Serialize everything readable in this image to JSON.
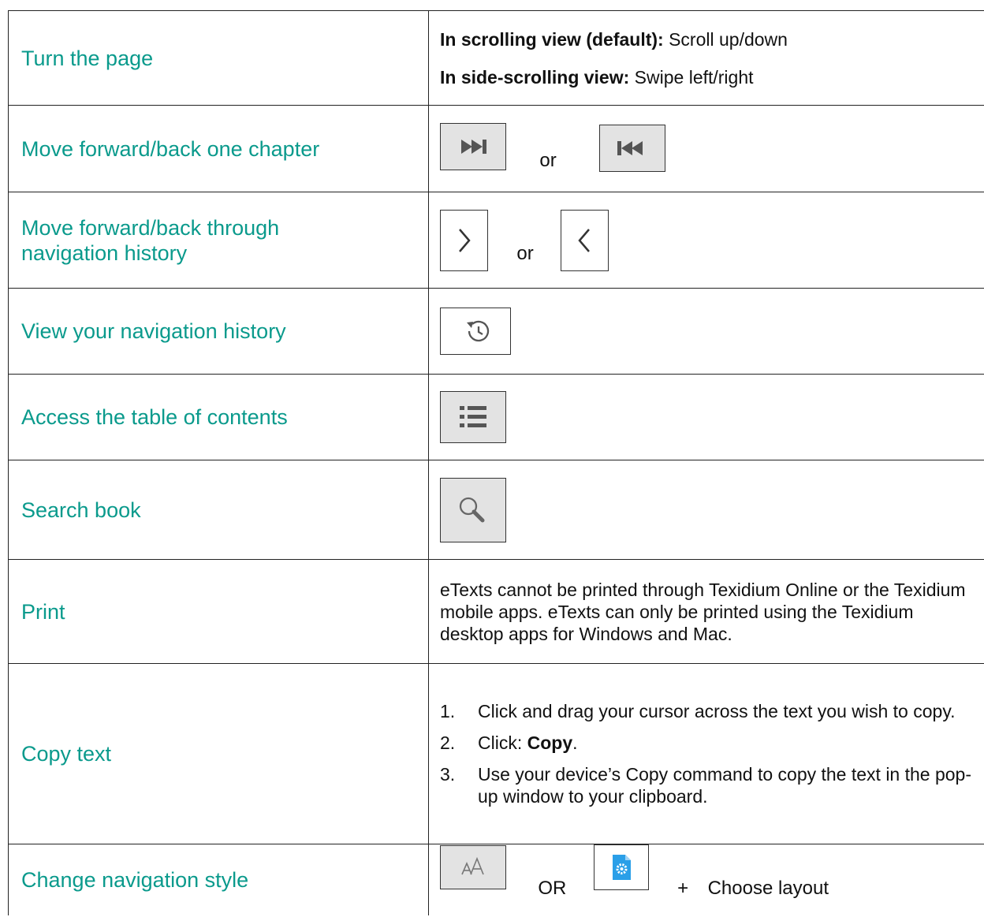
{
  "rows": [
    {
      "label": "Turn the page",
      "lines": [
        {
          "bold": "In scrolling view (default):",
          "text": " Scroll up/down"
        },
        {
          "bold": "In side-scrolling view:",
          "text": " Swipe left/right"
        }
      ]
    },
    {
      "label": "Move forward/back one chapter",
      "icons": [
        "skip-forward-icon",
        "skip-back-icon"
      ],
      "joiner": "or"
    },
    {
      "label": "Move forward/back through navigation history",
      "icons": [
        "chevron-right-icon",
        "chevron-left-icon"
      ],
      "joiner": "or"
    },
    {
      "label": "View your navigation history",
      "icons": [
        "history-clock-icon"
      ]
    },
    {
      "label": "Access the table of contents",
      "icons": [
        "list-icon"
      ]
    },
    {
      "label": "Search book",
      "icons": [
        "search-icon"
      ]
    },
    {
      "label": "Print",
      "text": "eTexts cannot be printed through Texidium Online or the Texidium mobile apps. eTexts can only be printed using the Texidium desktop apps for Windows and Mac."
    },
    {
      "label": "Copy text",
      "steps": [
        {
          "num": "1.",
          "text": "Click and drag your cursor across the text you wish to copy."
        },
        {
          "num": "2.",
          "pre": "Click: ",
          "bold": "Copy",
          "post": "."
        },
        {
          "num": "3.",
          "text": "Use your device’s Copy command to copy the text in the pop-up window to your clipboard."
        }
      ]
    },
    {
      "label": "Change navigation style",
      "icons": [
        "font-size-icon",
        "settings-file-icon"
      ],
      "joiner": "OR",
      "plus": "+",
      "suffix": "Choose layout"
    }
  ],
  "colors": {
    "label": "#0a9a8c",
    "border": "#222222",
    "icon_fill": "#e3e3e3",
    "settings_blue": "#2a9fe8"
  }
}
